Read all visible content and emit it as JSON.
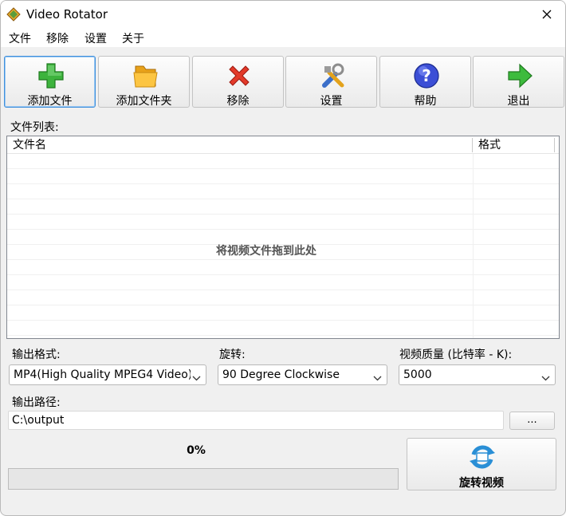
{
  "window": {
    "title": "Video Rotator"
  },
  "menu": [
    "文件",
    "移除",
    "设置",
    "关于"
  ],
  "toolbar": [
    {
      "label": "添加文件",
      "icon": "add-file-icon"
    },
    {
      "label": "添加文件夹",
      "icon": "folder-icon"
    },
    {
      "label": "移除",
      "icon": "remove-icon"
    },
    {
      "label": "设置",
      "icon": "settings-icon"
    },
    {
      "label": "帮助",
      "icon": "help-icon"
    },
    {
      "label": "退出",
      "icon": "exit-icon"
    }
  ],
  "file_list": {
    "label": "文件列表:",
    "columns": [
      "文件名",
      "格式"
    ],
    "empty_hint": "将视频文件拖到此处"
  },
  "output_format": {
    "label": "输出格式:",
    "value": "MP4(High Quality MPEG4 Video)"
  },
  "rotation": {
    "label": "旋转:",
    "value": "90 Degree Clockwise"
  },
  "quality": {
    "label": "视频质量 (比特率 - K):",
    "value": "5000"
  },
  "output_path": {
    "label": "输出路径:",
    "value": "C:\\output",
    "browse_label": "..."
  },
  "progress": {
    "text": "0%",
    "value": 0
  },
  "rotate_button": {
    "label": "旋转视频"
  },
  "colors": {
    "selected_border": "#3f8fdb",
    "window_bg": "#f0f0f0",
    "progress_fill": "#06b025"
  }
}
